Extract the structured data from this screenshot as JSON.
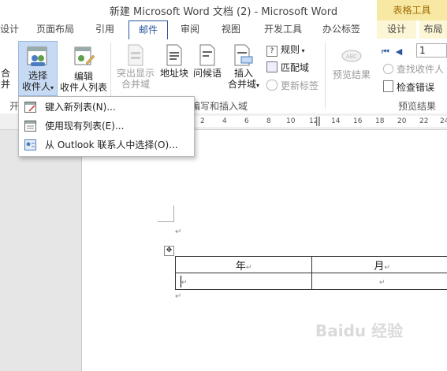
{
  "window": {
    "title": "新建 Microsoft Word 文档 (2) - Microsoft Word",
    "context_group": "表格工具"
  },
  "tabs": [
    "设计",
    "页面布局",
    "引用",
    "邮件",
    "审阅",
    "视图",
    "开发工具",
    "办公标签",
    "设计",
    "布局"
  ],
  "ribbon": {
    "start_merge_fragment": [
      "合",
      "并"
    ],
    "select_recipients": [
      "选择",
      "收件人"
    ],
    "edit_recipients": [
      "编辑",
      "收件人列表"
    ],
    "highlight_fields": [
      "突出显示",
      "合并域"
    ],
    "address_block": "地址块",
    "greeting_line": "问候语",
    "insert_merge_field": [
      "插入",
      "合并域"
    ],
    "rules": "规则",
    "match_fields": "匹配域",
    "update_labels": "更新标签",
    "preview_results": "预览结果",
    "record_value": "1",
    "find_recipient": "查找收件人",
    "check_errors": "检查错误",
    "group_start": "开",
    "group_write_insert": "编写和插入域",
    "group_preview": "预览结果"
  },
  "ruler_ticks": [
    "2",
    "4",
    "6",
    "8",
    "10",
    "12",
    "14",
    "16",
    "18",
    "20",
    "22",
    "24"
  ],
  "dropdown": {
    "items": [
      "键入新列表(N)...",
      "使用现有列表(E)...",
      "从 Outlook 联系人中选择(O)..."
    ]
  },
  "document": {
    "table_headers": [
      "年",
      "月"
    ],
    "para_mark": "↵",
    "move_handle": "✥"
  },
  "watermark": "Baidu 经验",
  "colors": {
    "accent": "#2b579a",
    "context_tab": "#f7e8a4",
    "context_text": "#a36b00"
  }
}
